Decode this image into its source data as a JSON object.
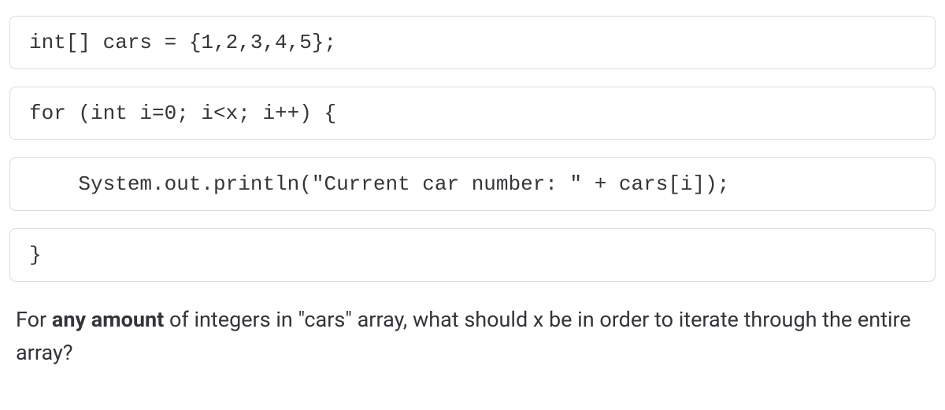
{
  "code": {
    "line1": "int[] cars = {1,2,3,4,5};",
    "line2": "for (int i=0; i<x; i++) {",
    "line3": "    System.out.println(\"Current car number: \" + cars[i]);",
    "line4": "}"
  },
  "question": {
    "prefix": "For ",
    "bold": "any amount",
    "suffix": " of integers in \"cars\" array, what should x be in order to iterate through the entire array?"
  }
}
